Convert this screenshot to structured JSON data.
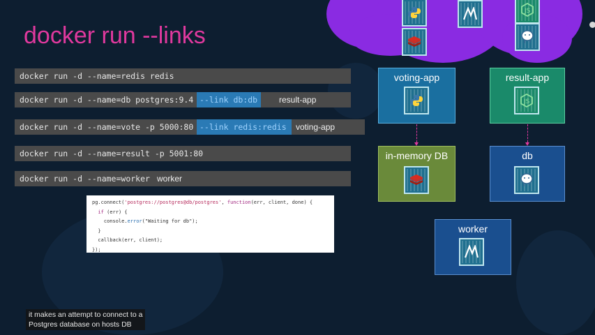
{
  "slide": {
    "title": "docker run --links",
    "commands": [
      {
        "text": "docker run -d --name=redis redis"
      },
      {
        "text": "docker run -d --name=db postgres:9.4",
        "link": "--link db:db",
        "tag": "result-app"
      },
      {
        "text": "docker run -d --name=vote -p 5000:80",
        "link": "--link redis:redis",
        "tag": "voting-app"
      },
      {
        "text": "docker run -d --name=result -p 5001:80"
      },
      {
        "text": "docker run -d --name=worker",
        "tag": "worker"
      }
    ],
    "code_lines": [
      [
        "pg.connect(",
        "'postgres://postgres@db/postgres'",
        ", ",
        "function",
        "(err, client, done) {"
      ],
      [
        "  ",
        "if",
        " (err) {"
      ],
      [
        "    console.",
        "error",
        "(\"Waiting for db\");"
      ],
      [
        "  }"
      ],
      [
        "  callback(err, client);"
      ],
      [
        "});"
      ]
    ]
  },
  "diagram": {
    "voting_app": {
      "label": "voting-app",
      "color": "#1a6fa0"
    },
    "result_app": {
      "label": "result-app",
      "color": "#1a8a6a"
    },
    "in_memory_db": {
      "label": "in-memory DB",
      "color": "#6a8a3a"
    },
    "db": {
      "label": "db",
      "color": "#1a4f8f"
    },
    "worker": {
      "label": "worker",
      "color": "#1a4f8f"
    },
    "icons": [
      "python-icon",
      "redis-icon",
      "dotnet-icon",
      "nodejs-icon",
      "postgres-icon"
    ]
  },
  "caption": {
    "line1": "it makes an attempt to connect to a",
    "line2": "Postgres database on hosts DB"
  }
}
